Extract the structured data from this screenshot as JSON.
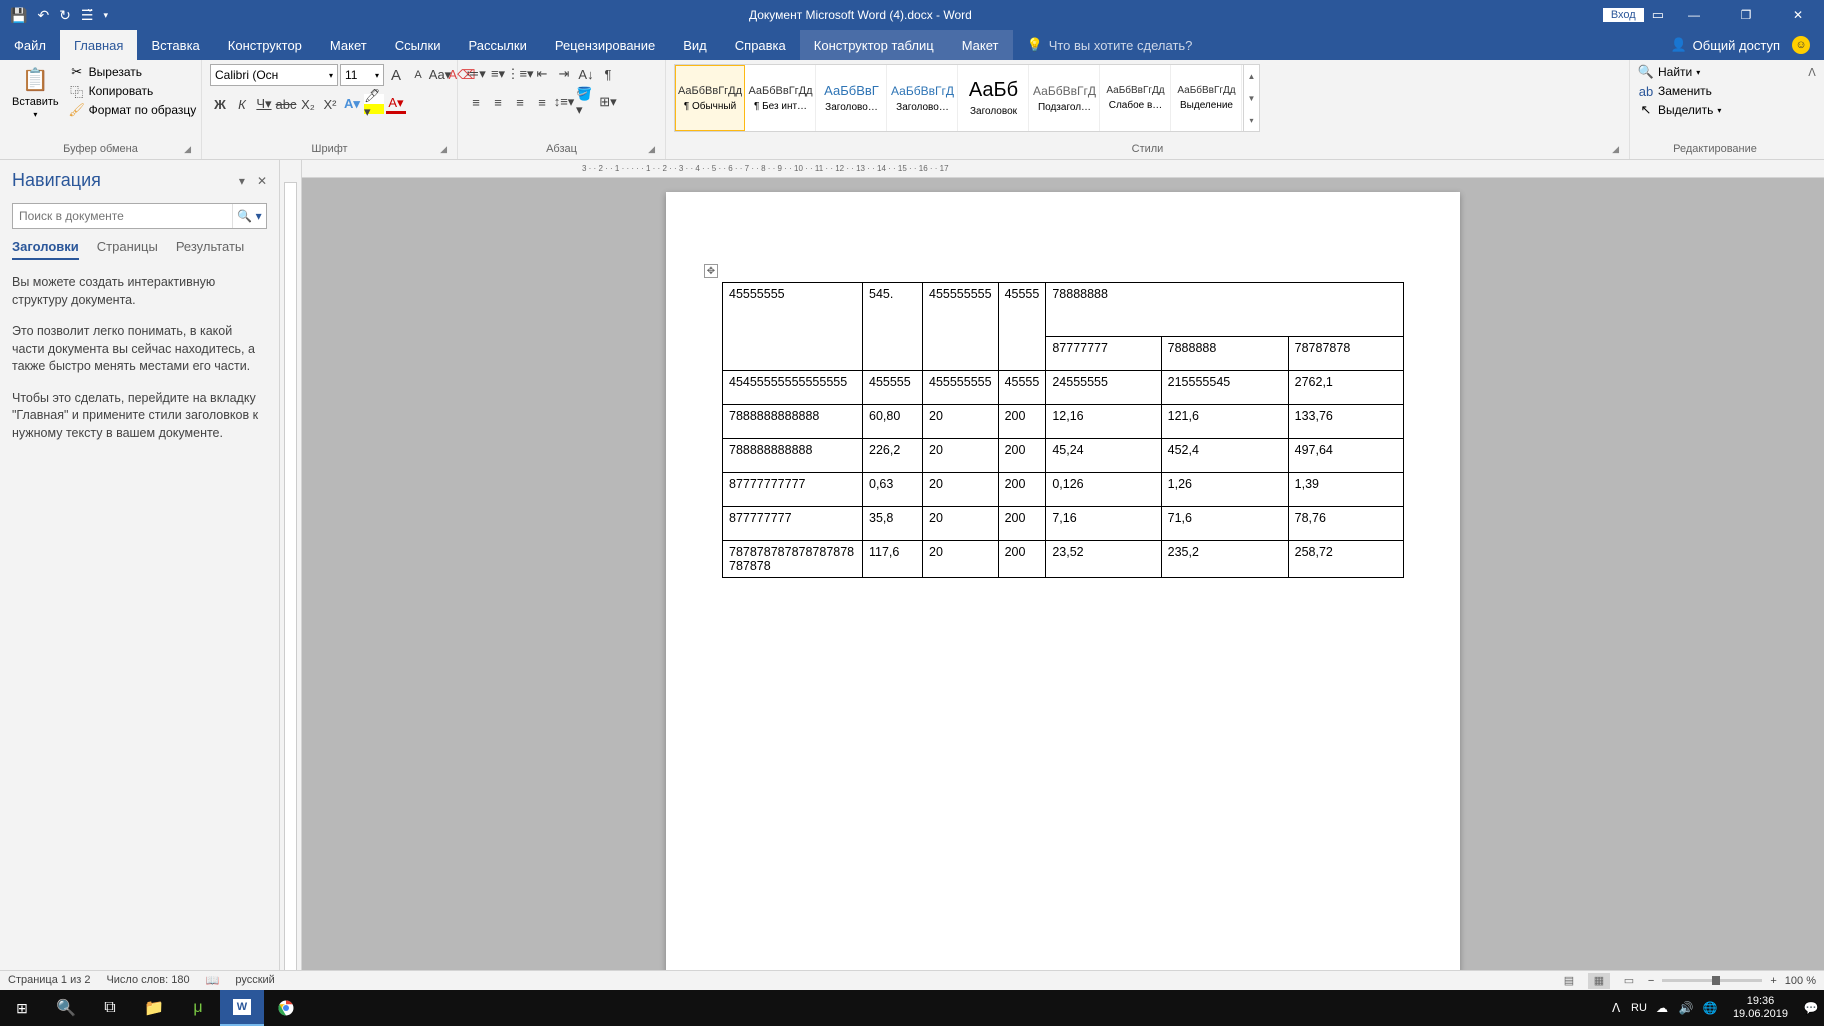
{
  "titlebar": {
    "document_title": "Документ Microsoft Word (4).docx  -  Word",
    "login": "Вход"
  },
  "tabs": {
    "file": "Файл",
    "home": "Главная",
    "insert": "Вставка",
    "design": "Конструктор",
    "layout": "Макет",
    "references": "Ссылки",
    "mailings": "Рассылки",
    "review": "Рецензирование",
    "view": "Вид",
    "help": "Справка",
    "table_design": "Конструктор таблиц",
    "table_layout": "Макет",
    "tell_me": "Что вы хотите сделать?",
    "share": "Общий доступ"
  },
  "ribbon": {
    "clipboard": {
      "paste": "Вставить",
      "cut": "Вырезать",
      "copy": "Копировать",
      "format_painter": "Формат по образцу",
      "label": "Буфер обмена"
    },
    "font": {
      "name": "Calibri (Осн",
      "size": "11",
      "label": "Шрифт"
    },
    "paragraph": {
      "label": "Абзац"
    },
    "styles": {
      "label": "Стили",
      "items": [
        {
          "preview": "АаБбВвГгДд",
          "name": "¶ Обычный"
        },
        {
          "preview": "АаБбВвГгДд",
          "name": "¶ Без инт…"
        },
        {
          "preview": "АаБбВвГ",
          "name": "Заголово…"
        },
        {
          "preview": "АаБбВвГгД",
          "name": "Заголово…"
        },
        {
          "preview": "АаБб",
          "name": "Заголовок"
        },
        {
          "preview": "АаБбВвГгД",
          "name": "Подзагол…"
        },
        {
          "preview": "АаБбВвГгДд",
          "name": "Слабое в…"
        },
        {
          "preview": "АаБбВвГгДд",
          "name": "Выделение"
        }
      ]
    },
    "editing": {
      "find": "Найти",
      "replace": "Заменить",
      "select": "Выделить",
      "label": "Редактирование"
    }
  },
  "nav": {
    "title": "Навигация",
    "search_placeholder": "Поиск в документе",
    "tabs": {
      "headings": "Заголовки",
      "pages": "Страницы",
      "results": "Результаты"
    },
    "p1": "Вы можете создать интерактивную структуру документа.",
    "p2": "Это позволит легко понимать, в какой части документа вы сейчас находитесь, а также быстро менять местами его части.",
    "p3": "Чтобы это сделать, перейдите на вкладку \"Главная\" и примените стили заголовков к нужному тексту в вашем документе."
  },
  "table": {
    "row1": [
      "45555555",
      "545.",
      "455555555",
      "45555",
      "78888888"
    ],
    "sub": [
      "87777777",
      "7888888",
      "78787878"
    ],
    "rows": [
      [
        "45455555555555555",
        "455555",
        "455555555",
        "45555",
        "24555555",
        "215555545",
        "2762,1"
      ],
      [
        "7888888888888",
        "60,80",
        "20",
        "200",
        "12,16",
        "121,6",
        "133,76"
      ],
      [
        "788888888888",
        "226,2",
        "20",
        "200",
        "45,24",
        "452,4",
        "497,64"
      ],
      [
        "87777777777",
        "0,63",
        "20",
        "200",
        "0,126",
        "1,26",
        "1,39"
      ],
      [
        "877777777",
        "35,8",
        "20",
        "200",
        "7,16",
        "71,6",
        "78,76"
      ],
      [
        "787878787878787878787878",
        "117,6",
        "20",
        "200",
        "23,52",
        "235,2",
        "258,72"
      ]
    ]
  },
  "status": {
    "page": "Страница 1 из 2",
    "words": "Число слов: 180",
    "lang": "русский",
    "zoom": "100 %"
  },
  "taskbar": {
    "lang": "RU",
    "time": "19:36",
    "date": "19.06.2019"
  }
}
